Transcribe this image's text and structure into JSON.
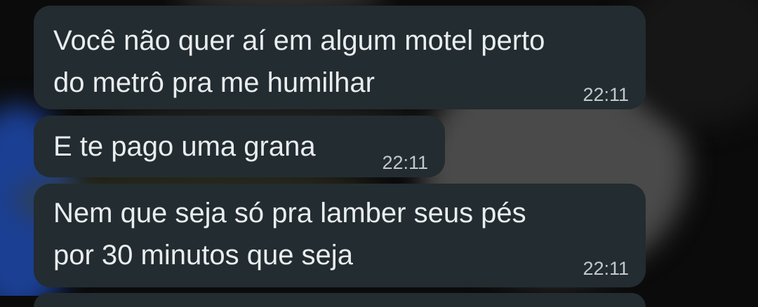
{
  "messages": [
    {
      "lines": [
        "Você não quer aí em algum motel perto",
        "do metrô pra me humilhar"
      ],
      "time": "22:11"
    },
    {
      "lines": [
        "E te pago uma grana"
      ],
      "time": "22:11"
    },
    {
      "lines": [
        "Nem que seja só pra lamber seus pés",
        "por 30 minutos que seja"
      ],
      "time": "22:11"
    }
  ]
}
